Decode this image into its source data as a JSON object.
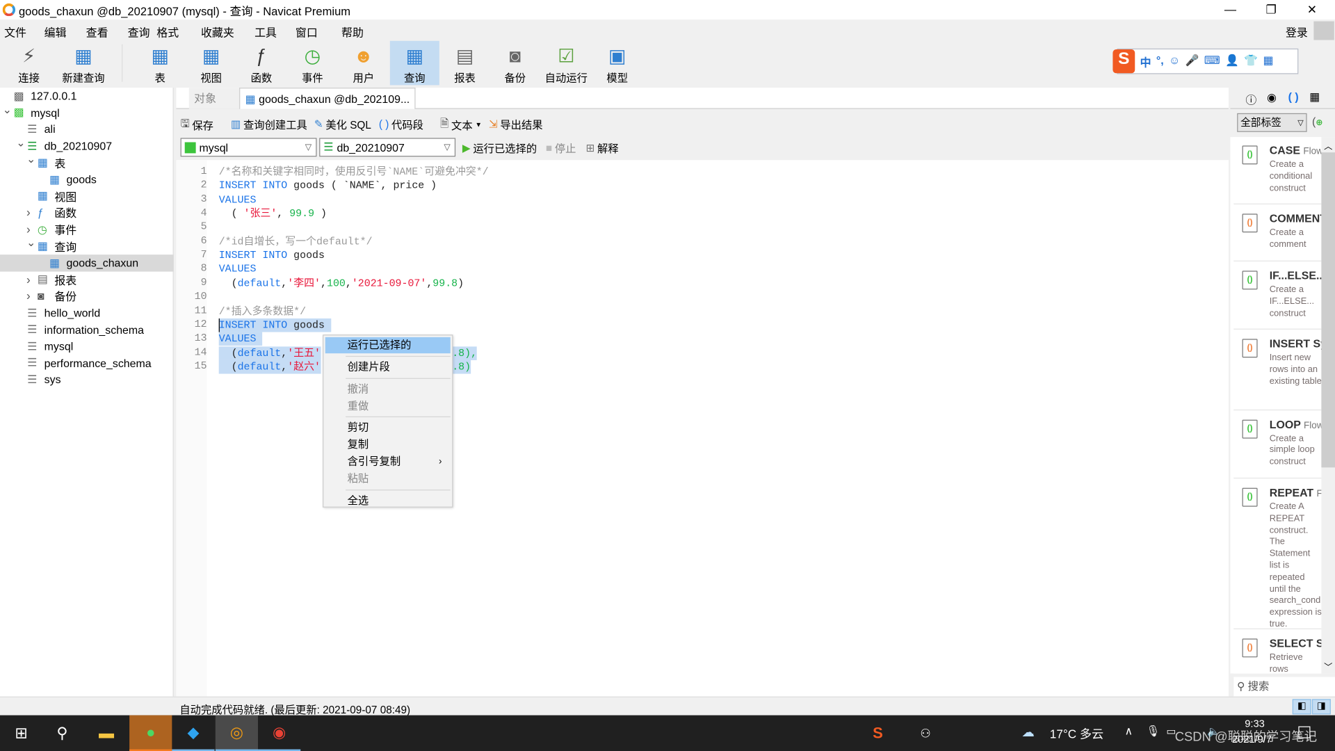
{
  "window": {
    "title": "goods_chaxun @db_20210907 (mysql) - 查询 - Navicat Premium",
    "minimize": "—",
    "restore": "❐",
    "close": "✕"
  },
  "menu": [
    "文件",
    "编辑",
    "查看",
    "查询",
    "格式",
    "收藏夹",
    "工具",
    "窗口",
    "帮助"
  ],
  "login": "登录",
  "toolbar": [
    {
      "label": "连接",
      "icon": "connect-icon"
    },
    {
      "label": "新建查询",
      "icon": "new-query-icon"
    },
    {
      "label": "表",
      "icon": "table-icon"
    },
    {
      "label": "视图",
      "icon": "view-icon"
    },
    {
      "label": "函数",
      "icon": "function-icon"
    },
    {
      "label": "事件",
      "icon": "event-clock-icon"
    },
    {
      "label": "用户",
      "icon": "user-icon"
    },
    {
      "label": "查询",
      "icon": "query-icon",
      "active": true
    },
    {
      "label": "报表",
      "icon": "report-icon"
    },
    {
      "label": "备份",
      "icon": "backup-icon"
    },
    {
      "label": "自动运行",
      "icon": "automation-icon"
    },
    {
      "label": "模型",
      "icon": "model-icon"
    }
  ],
  "ime": {
    "items": [
      "中",
      "°,",
      "☺",
      "🎤",
      "⌨",
      "👤",
      "👕",
      "▦"
    ]
  },
  "tree": [
    {
      "label": "127.0.0.1",
      "level": 0,
      "icon": "server-icon"
    },
    {
      "label": "mysql",
      "level": 0,
      "icon": "mysql-connection-icon",
      "expanded": true
    },
    {
      "label": "ali",
      "level": 1,
      "icon": "database-icon"
    },
    {
      "label": "db_20210907",
      "level": 1,
      "icon": "database-icon",
      "expanded": true
    },
    {
      "label": "表",
      "level": 2,
      "icon": "table-icon",
      "expanded": true
    },
    {
      "label": "goods",
      "level": 3,
      "icon": "table-icon"
    },
    {
      "label": "视图",
      "level": 2,
      "icon": "view-icon"
    },
    {
      "label": "函数",
      "level": 2,
      "icon": "function-icon",
      "collapsed": true
    },
    {
      "label": "事件",
      "level": 2,
      "icon": "event-icon",
      "collapsed": true
    },
    {
      "label": "查询",
      "level": 2,
      "icon": "query-icon",
      "expanded": true
    },
    {
      "label": "goods_chaxun",
      "level": 3,
      "icon": "query-icon",
      "selected": true
    },
    {
      "label": "报表",
      "level": 2,
      "icon": "report-icon",
      "collapsed": true
    },
    {
      "label": "备份",
      "level": 2,
      "icon": "backup-icon",
      "collapsed": true
    },
    {
      "label": "hello_world",
      "level": 1,
      "icon": "database-icon"
    },
    {
      "label": "information_schema",
      "level": 1,
      "icon": "database-icon"
    },
    {
      "label": "mysql",
      "level": 1,
      "icon": "database-icon"
    },
    {
      "label": "performance_schema",
      "level": 1,
      "icon": "database-icon"
    },
    {
      "label": "sys",
      "level": 1,
      "icon": "database-icon"
    }
  ],
  "tabs": {
    "objects": "对象",
    "query": "goods_chaxun @db_202109..."
  },
  "editor_toolbar": {
    "save": "保存",
    "builder": "查询创建工具",
    "beautify": "美化 SQL",
    "snippet": "代码段",
    "text": "文本",
    "export": "导出结果",
    "connection": "mysql",
    "database": "db_20210907",
    "run_selected": "运行已选择的",
    "stop": "停止",
    "explain": "解释"
  },
  "code": [
    [
      {
        "t": "/*名称和关键字相同时，使用反引号`NAME`可避免冲突*/",
        "c": "cm"
      }
    ],
    [
      {
        "t": "INSERT INTO ",
        "c": "kw"
      },
      {
        "t": "goods ( `NAME`, price )",
        "c": "tx"
      }
    ],
    [
      {
        "t": "VALUES",
        "c": "kw"
      }
    ],
    [
      {
        "t": "  ( ",
        "c": "tx"
      },
      {
        "t": "'张三'",
        "c": "st"
      },
      {
        "t": ", ",
        "c": "tx"
      },
      {
        "t": "99.9",
        "c": "nm"
      },
      {
        "t": " )",
        "c": "tx"
      }
    ],
    [],
    [
      {
        "t": "/*id自增长，写一个default*/",
        "c": "cm"
      }
    ],
    [
      {
        "t": "INSERT INTO ",
        "c": "kw"
      },
      {
        "t": "goods",
        "c": "tx"
      }
    ],
    [
      {
        "t": "VALUES",
        "c": "kw"
      }
    ],
    [
      {
        "t": "  (",
        "c": "tx"
      },
      {
        "t": "default",
        "c": "kw"
      },
      {
        "t": ",",
        "c": "tx"
      },
      {
        "t": "'李四'",
        "c": "st"
      },
      {
        "t": ",",
        "c": "tx"
      },
      {
        "t": "100",
        "c": "nm"
      },
      {
        "t": ",",
        "c": "tx"
      },
      {
        "t": "'2021-09-07'",
        "c": "st"
      },
      {
        "t": ",",
        "c": "tx"
      },
      {
        "t": "99.8",
        "c": "nm"
      },
      {
        "t": ")",
        "c": "tx"
      }
    ],
    [],
    [
      {
        "t": "/*插入多条数据*/",
        "c": "cm"
      }
    ],
    [
      {
        "t": "INSERT INTO ",
        "c": "kw"
      },
      {
        "t": "goods ",
        "c": "tx"
      }
    ],
    [
      {
        "t": "VALUES ",
        "c": "kw"
      }
    ],
    [
      {
        "t": "  (",
        "c": "tx"
      },
      {
        "t": "default",
        "c": "kw"
      },
      {
        "t": ",",
        "c": "tx"
      },
      {
        "t": "'王五'",
        "c": "st"
      }
    ],
    [
      {
        "t": "  (",
        "c": "tx"
      },
      {
        "t": "default",
        "c": "kw"
      },
      {
        "t": ",",
        "c": "tx"
      },
      {
        "t": "'赵六'",
        "c": "st"
      }
    ]
  ],
  "code_tails": {
    "14": ".8),",
    "15": ".8)"
  },
  "context_menu": [
    {
      "label": "运行已选择的",
      "highlighted": true
    },
    {
      "sep": true
    },
    {
      "label": "创建片段"
    },
    {
      "sep": true
    },
    {
      "label": "撤消",
      "disabled": true
    },
    {
      "label": "重做",
      "disabled": true
    },
    {
      "sep": true
    },
    {
      "label": "剪切"
    },
    {
      "label": "复制"
    },
    {
      "label": "含引号复制",
      "submenu": true
    },
    {
      "label": "粘贴",
      "disabled": true
    },
    {
      "sep": true
    },
    {
      "label": "全选"
    }
  ],
  "right_panel": {
    "filter": "全部标签",
    "search_placeholder": "搜索",
    "snippets": [
      {
        "name": "CASE",
        "tag": "Flow",
        "desc": "Create a conditional construct",
        "color": "green"
      },
      {
        "name": "COMMENT",
        "tag": "",
        "desc": "Create a comment",
        "color": "multi"
      },
      {
        "name": "IF...ELSE...",
        "tag": "",
        "desc": "Create a IF...ELSE... construct",
        "color": "green"
      },
      {
        "name": "INSERT Sy",
        "tag": "",
        "desc": "Insert new rows into an existing table",
        "color": "multi"
      },
      {
        "name": "LOOP",
        "tag": "Flow",
        "desc": "Create a simple loop construct",
        "color": "green"
      },
      {
        "name": "REPEAT",
        "tag": "Fl",
        "desc": "Create A REPEAT construct. The Statement list is repeated until the search_cond expression is true.",
        "color": "green"
      },
      {
        "name": "SELECT Sy",
        "tag": "",
        "desc": "Retrieve rows selected",
        "color": "multi"
      }
    ]
  },
  "status": {
    "text": "自动完成代码就绪. (最后更新: 2021-09-07 08:49)"
  },
  "taskbar": {
    "weather": "17°C 多云",
    "time": "9:33",
    "date": "2021/9/7",
    "watermark": "CSDN @聪聪的学习笔记"
  },
  "colors": {
    "accent": "#1a73e8",
    "selection": "#c5dcf5",
    "menu_highlight": "#99c9f5",
    "string": "#e8173a",
    "number": "#16b34a",
    "comment": "#999999"
  }
}
